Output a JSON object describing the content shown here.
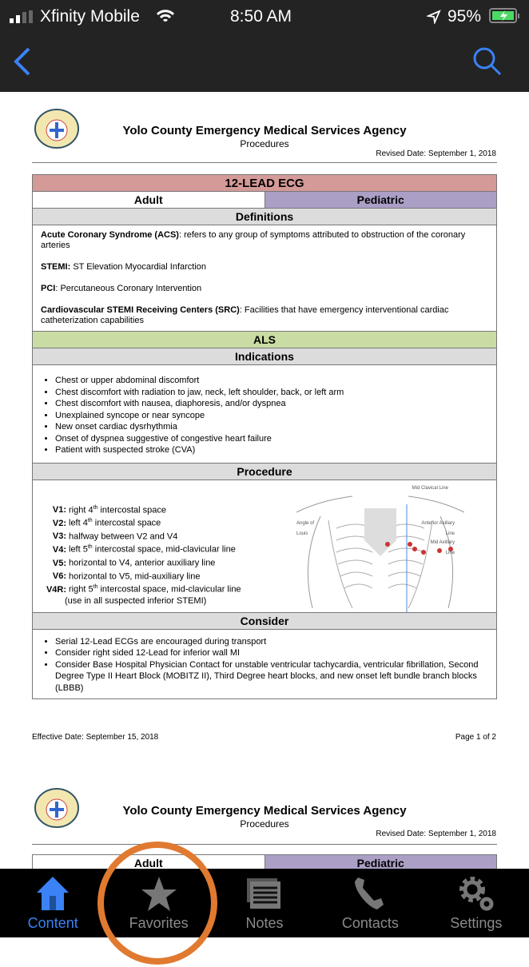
{
  "status": {
    "carrier": "Xfinity Mobile",
    "time": "8:50 AM",
    "battery": "95%"
  },
  "nav": {
    "back_icon": "chevron-left-icon",
    "search_icon": "search-icon",
    "accent": "#3a82f6"
  },
  "document": {
    "agency": "Yolo County Emergency Medical Services Agency",
    "subtitle": "Procedures",
    "revised": "Revised Date: September 1, 2018",
    "title": "12-LEAD ECG",
    "adult": "Adult",
    "pediatric": "Pediatric",
    "definitions_header": "Definitions",
    "definitions": [
      {
        "term": "Acute Coronary Syndrome (ACS)",
        "text": ": refers to any group of symptoms attributed to obstruction of the coronary arteries"
      },
      {
        "term": "STEMI:",
        "text": " ST Elevation Myocardial Infarction"
      },
      {
        "term": "PCI",
        "text": ": Percutaneous Coronary Intervention"
      },
      {
        "term": "Cardiovascular STEMI Receiving Centers (SRC)",
        "text": ": Facilities that have emergency interventional cardiac catheterization capabilities"
      }
    ],
    "als": "ALS",
    "indications_header": "Indications",
    "indications": [
      "Chest or upper abdominal discomfort",
      "Chest discomfort with radiation to jaw, neck, left shoulder, back, or left arm",
      "Chest discomfort with nausea, diaphoresis, and/or dyspnea",
      "Unexplained syncope or near syncope",
      "New onset cardiac dysrhythmia",
      "Onset of dyspnea suggestive of congestive heart failure",
      "Patient with suspected stroke (CVA)"
    ],
    "procedure_header": "Procedure",
    "leads": [
      {
        "lead": "V1:",
        "pre": "right 4",
        "sup": "th",
        "post": " intercostal space"
      },
      {
        "lead": "V2:",
        "pre": "left 4",
        "sup": "th",
        "post": " intercostal space"
      },
      {
        "lead": "V3:",
        "pre": "halfway between V2 and V4",
        "sup": "",
        "post": ""
      },
      {
        "lead": "V4:",
        "pre": "left 5",
        "sup": "th",
        "post": " intercostal space, mid-clavicular line"
      },
      {
        "lead": "V5:",
        "pre": "horizontal to V4, anterior auxiliary line",
        "sup": "",
        "post": ""
      },
      {
        "lead": "V6:",
        "pre": "horizontal to V5, mid-auxiliary line",
        "sup": "",
        "post": ""
      },
      {
        "lead": "V4R:",
        "pre": "right 5",
        "sup": "th",
        "post": " intercostal space, mid-clavicular line"
      }
    ],
    "lead_note": "(use in all suspected inferior STEMI)",
    "diagram_labels": {
      "mid_clavical": "Mid Clavical Line",
      "angle": "Angle of Louis",
      "anterior": "Anterior Axillary Line",
      "mid_axillary": "Mid Axillary Line"
    },
    "consider_header": "Consider",
    "consider": [
      "Serial 12-Lead ECGs are encouraged during transport",
      "Consider right sided 12-Lead for inferior wall MI",
      "Consider Base Hospital Physician Contact for unstable ventricular tachycardia, ventricular fibrillation, Second Degree Type II Heart Block (MOBITZ II), Third Degree heart blocks, and new onset left bundle branch blocks (LBBB)"
    ],
    "effective": "Effective Date: September 15, 2018",
    "page": "Page 1 of 2",
    "colors": {
      "title": "#d49a98",
      "pediatric": "#ab9fc6",
      "als": "#c9dca3",
      "header": "#dcdcdc"
    }
  },
  "tabs": [
    {
      "label": "Content",
      "icon": "home-icon",
      "active": true
    },
    {
      "label": "Favorites",
      "icon": "star-icon"
    },
    {
      "label": "Notes",
      "icon": "notes-icon"
    },
    {
      "label": "Contacts",
      "icon": "phone-icon"
    },
    {
      "label": "Settings",
      "icon": "gear-icon"
    }
  ],
  "annotation_color": "#e07a30"
}
